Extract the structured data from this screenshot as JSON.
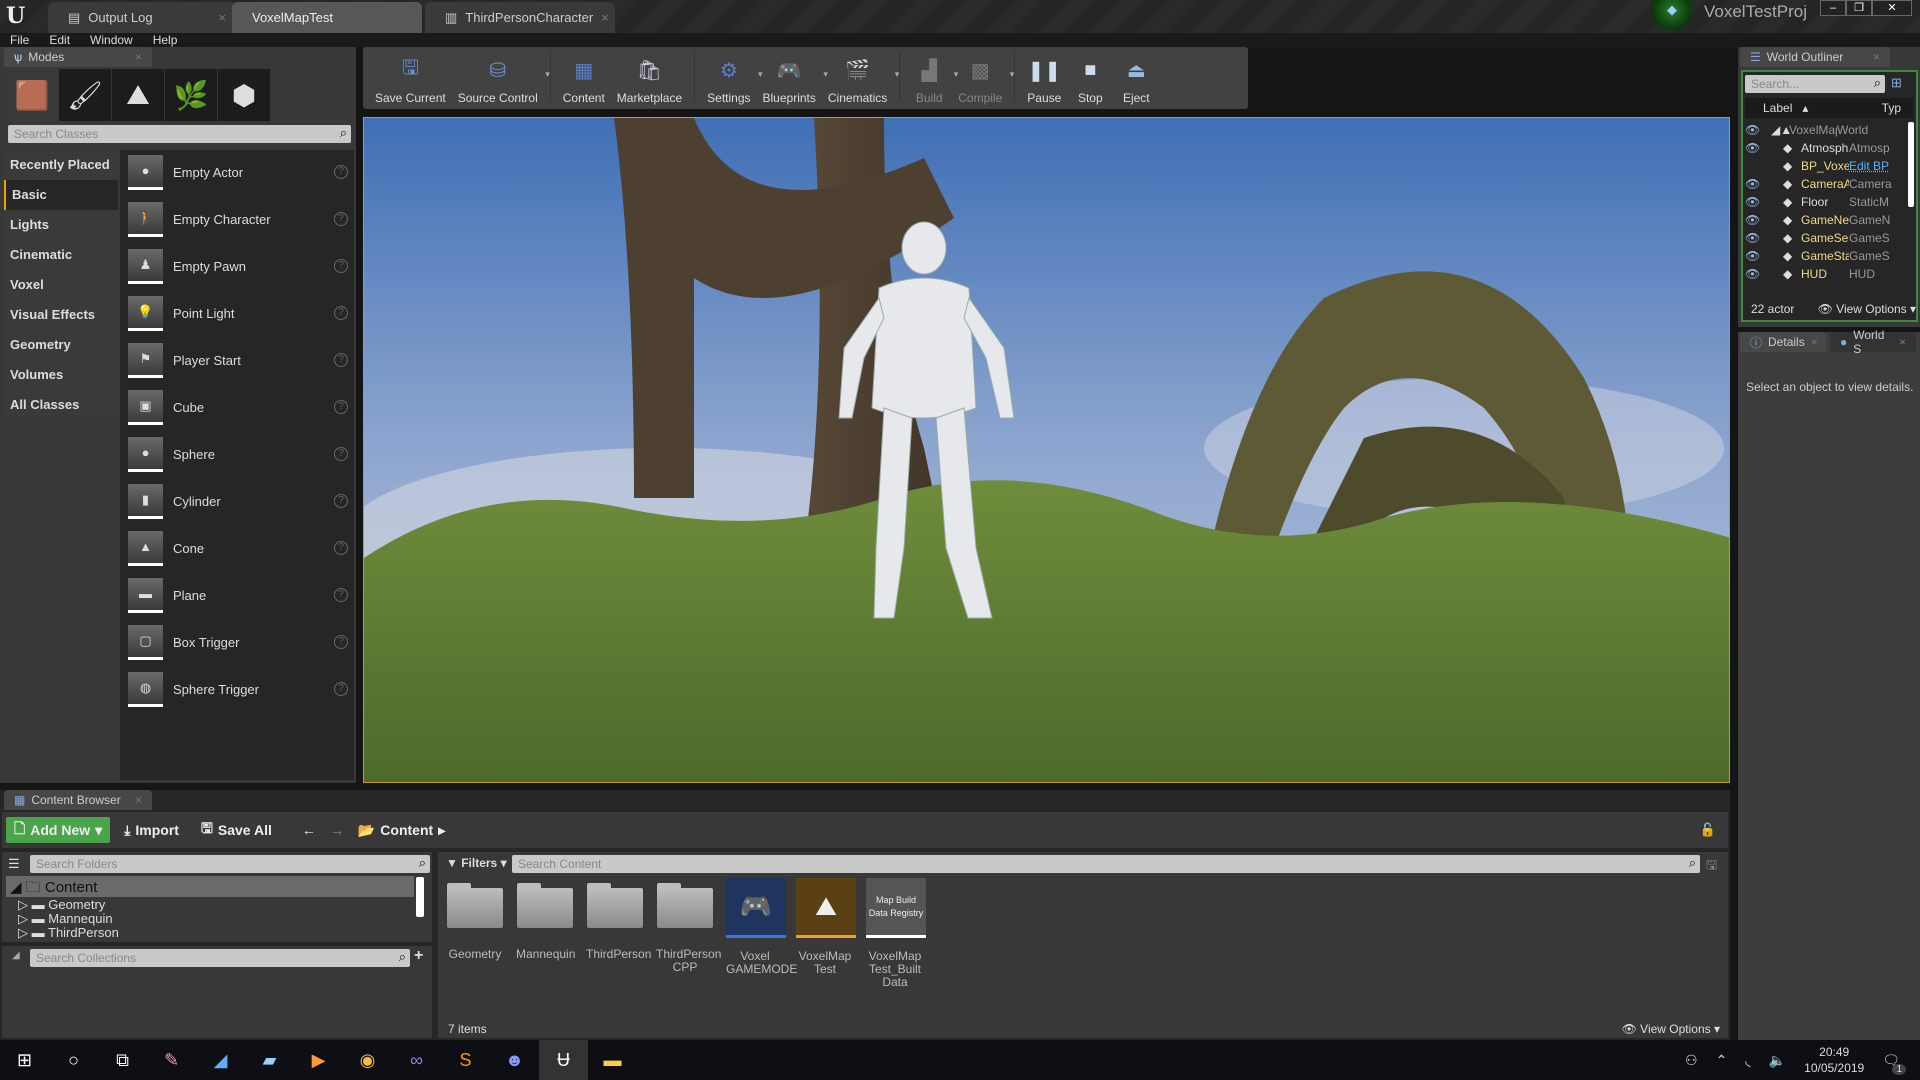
{
  "app": {
    "title": "VoxelTestProj",
    "doc_tabs": [
      {
        "label": "Output Log"
      },
      {
        "label": "VoxelMapTest"
      },
      {
        "label": "ThirdPersonCharacter"
      }
    ],
    "menu": [
      "File",
      "Edit",
      "Window",
      "Help"
    ]
  },
  "modes": {
    "tab": "Modes",
    "search_placeholder": "Search Classes",
    "categories": [
      "Recently Placed",
      "Basic",
      "Lights",
      "Cinematic",
      "Voxel",
      "Visual Effects",
      "Geometry",
      "Volumes",
      "All Classes"
    ],
    "selected_category": "Basic",
    "items": [
      "Empty Actor",
      "Empty Character",
      "Empty Pawn",
      "Point Light",
      "Player Start",
      "Cube",
      "Sphere",
      "Cylinder",
      "Cone",
      "Plane",
      "Box Trigger",
      "Sphere Trigger"
    ]
  },
  "toolbar": [
    {
      "label": "Save Current",
      "icon": "save-icon"
    },
    {
      "label": "Source Control",
      "icon": "source-control-icon",
      "dropdown": true
    },
    {
      "label": "Content",
      "icon": "content-icon"
    },
    {
      "label": "Marketplace",
      "icon": "marketplace-icon"
    },
    {
      "label": "Settings",
      "icon": "settings-icon",
      "dropdown": true
    },
    {
      "label": "Blueprints",
      "icon": "blueprints-icon",
      "dropdown": true
    },
    {
      "label": "Cinematics",
      "icon": "cinematics-icon",
      "dropdown": true
    },
    {
      "label": "Build",
      "icon": "build-icon",
      "dropdown": true,
      "disabled": true
    },
    {
      "label": "Compile",
      "icon": "compile-icon",
      "dropdown": true,
      "disabled": true
    },
    {
      "label": "Pause",
      "icon": "pause-icon"
    },
    {
      "label": "Stop",
      "icon": "stop-icon"
    },
    {
      "label": "Eject",
      "icon": "eject-icon"
    }
  ],
  "outliner": {
    "tab": "World Outliner",
    "search_placeholder": "Search...",
    "col_label": "Label",
    "col_type": "Typ",
    "rows": [
      {
        "label": "VoxelMapT",
        "type": "World"
      },
      {
        "label": "Atmosph",
        "type": "Atmosp"
      },
      {
        "label": "BP_Voxe",
        "type": "Edit BP"
      },
      {
        "label": "CameraA",
        "type": "Camera"
      },
      {
        "label": "Floor",
        "type": "StaticM"
      },
      {
        "label": "GameNe",
        "type": "GameN"
      },
      {
        "label": "GameSe",
        "type": "GameS"
      },
      {
        "label": "GameSta",
        "type": "GameS"
      },
      {
        "label": "HUD",
        "type": "HUD"
      }
    ],
    "count": "22 actor",
    "view_options": "View Options"
  },
  "details": {
    "tabs": [
      "Details",
      "World S"
    ],
    "empty_msg": "Select an object to view details."
  },
  "content_browser": {
    "tab": "Content Browser",
    "add_new": "Add New",
    "import": "Import",
    "save_all": "Save All",
    "path": "Content",
    "folders_search": "Search Folders",
    "tree": {
      "root": "Content",
      "children": [
        "Geometry",
        "Mannequin",
        "ThirdPerson"
      ]
    },
    "collections_search": "Search Collections",
    "filters": "Filters",
    "content_search": "Search Content",
    "assets": [
      {
        "name": "Geometry",
        "kind": "folder"
      },
      {
        "name": "Mannequin",
        "kind": "folder"
      },
      {
        "name": "ThirdPerson",
        "kind": "folder"
      },
      {
        "name": "ThirdPerson CPP",
        "kind": "folder"
      },
      {
        "name": "Voxel GAMEMODE",
        "kind": "gamemode",
        "color": "#3a78e0"
      },
      {
        "name": "VoxelMap Test",
        "kind": "map",
        "color": "#f0a020"
      },
      {
        "name": "VoxelMap Test_Built Data",
        "kind": "registry",
        "thumb_text": "Map Build Data Registry",
        "color": "#ffffff"
      }
    ],
    "count": "7 items",
    "view_options": "View Options"
  },
  "taskbar": {
    "time": "20:49",
    "date": "10/05/2019",
    "notifications": "1"
  },
  "colors": {
    "accent": "#e8a00e",
    "add_new": "#4aa54a"
  }
}
